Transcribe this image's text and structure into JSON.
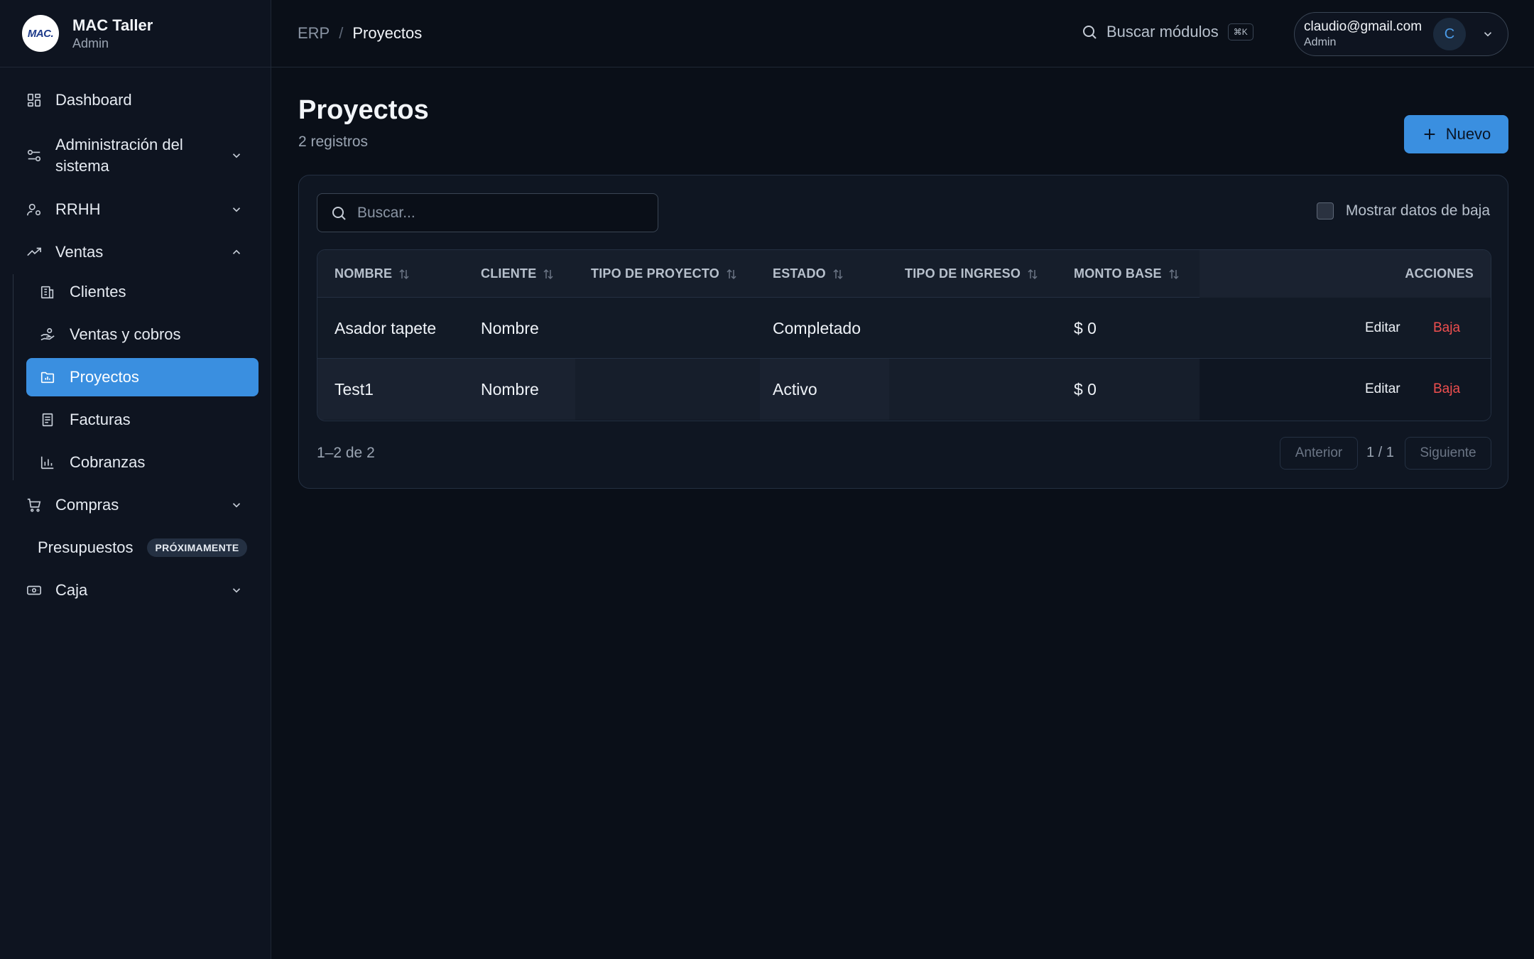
{
  "brand": {
    "logo_text": "MAC.",
    "name": "MAC Taller",
    "role": "Admin"
  },
  "topbar": {
    "breadcrumb": {
      "root": "ERP",
      "separator": "/",
      "current": "Proyectos"
    },
    "search_modules": {
      "label": "Buscar módulos",
      "shortcut": "⌘K"
    },
    "user": {
      "email": "claudio@gmail.com",
      "role": "Admin",
      "initial": "C"
    }
  },
  "sidebar": {
    "items": [
      {
        "label": "Dashboard",
        "icon": "dashboard-icon"
      },
      {
        "label": "Administración del sistema",
        "icon": "sliders-icon",
        "expanded": false
      },
      {
        "label": "RRHH",
        "icon": "user-gear-icon",
        "expanded": false
      },
      {
        "label": "Ventas",
        "icon": "trending-up-icon",
        "expanded": true
      },
      {
        "label": "Compras",
        "icon": "cart-icon",
        "expanded": false
      },
      {
        "label": "Caja",
        "icon": "cash-icon",
        "expanded": false
      }
    ],
    "ventas_children": [
      {
        "label": "Clientes",
        "icon": "building-icon"
      },
      {
        "label": "Ventas y cobros",
        "icon": "hand-coins-icon"
      },
      {
        "label": "Proyectos",
        "icon": "folder-chart-icon",
        "active": true
      },
      {
        "label": "Facturas",
        "icon": "receipt-icon"
      },
      {
        "label": "Cobranzas",
        "icon": "bar-chart-icon"
      }
    ],
    "presupuestos": {
      "label": "Presupuestos",
      "badge": "PRÓXIMAMENTE"
    }
  },
  "page": {
    "title": "Proyectos",
    "subtitle": "2 registros",
    "new_button": "Nuevo"
  },
  "filters": {
    "search_placeholder": "Buscar...",
    "show_inactive_label": "Mostrar datos de baja",
    "show_inactive_checked": false
  },
  "table": {
    "columns": [
      "NOMBRE",
      "CLIENTE",
      "TIPO DE PROYECTO",
      "ESTADO",
      "TIPO DE INGRESO",
      "MONTO BASE",
      "ACCIONES"
    ],
    "rows": [
      {
        "nombre": "Asador tapete",
        "cliente": "Nombre",
        "tipo_proyecto": "",
        "estado": "Completado",
        "tipo_ingreso": "",
        "monto_base": "$ 0",
        "edit": "Editar",
        "baja": "Baja"
      },
      {
        "nombre": "Test1",
        "cliente": "Nombre",
        "tipo_proyecto": "",
        "estado": "Activo",
        "tipo_ingreso": "",
        "monto_base": "$ 0",
        "edit": "Editar",
        "baja": "Baja"
      }
    ]
  },
  "pagination": {
    "range": "1–2 de 2",
    "prev": "Anterior",
    "page_info": "1 / 1",
    "next": "Siguiente"
  },
  "colors": {
    "accent": "#3a8fe0",
    "danger": "#ef4f4f",
    "background": "#0a0f18"
  }
}
